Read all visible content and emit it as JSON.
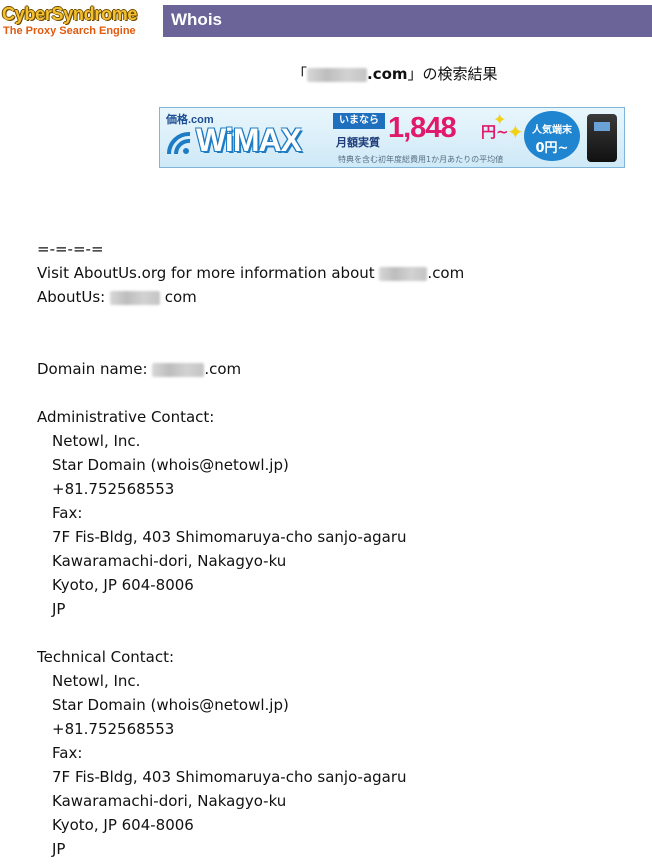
{
  "header": {
    "logo_main": "CyberSyndrome",
    "logo_sub": "The Proxy Search Engine",
    "title": "Whois"
  },
  "result": {
    "open_quote": "「",
    "domain_suffix": ".com",
    "close_text": "」の検索結果"
  },
  "banner": {
    "kakaku": "価格.com",
    "brand": "WiMAX",
    "now_label": "いまなら",
    "monthly_label": "月額実質",
    "price": "1,848",
    "yen": "円~",
    "popular_label": "人気端末",
    "popular_price": "0円~",
    "note": "特典を含む初年度総費用1か月あたりの平均値"
  },
  "whois": {
    "separator": "=-=-=-=",
    "visit_prefix": "Visit AboutUs.org for more information about ",
    "visit_suffix": ".com",
    "aboutus_prefix": "AboutUs: ",
    "aboutus_suffix": "com",
    "domain_prefix": "Domain name: ",
    "domain_suffix": ".com",
    "admin": {
      "heading": "Administrative Contact:",
      "lines": [
        "Netowl, Inc.",
        "Star Domain (whois@netowl.jp)",
        "+81.752568553",
        "Fax:",
        "7F Fis-Bldg, 403 Shimomaruya-cho sanjo-agaru",
        "Kawaramachi-dori, Nakagyo-ku",
        "Kyoto, JP 604-8006",
        "JP"
      ]
    },
    "tech": {
      "heading": "Technical Contact:",
      "lines": [
        "Netowl, Inc.",
        "Star Domain (whois@netowl.jp)",
        "+81.752568553",
        "Fax:",
        "7F Fis-Bldg, 403 Shimomaruya-cho sanjo-agaru",
        "Kawaramachi-dori, Nakagyo-ku",
        "Kyoto, JP 604-8006",
        "JP"
      ]
    }
  },
  "colors": {
    "title_bar": "#6a6499",
    "logo_gold": "#f5c030",
    "logo_orange": "#e05a10",
    "price_pink": "#e0196b",
    "wimax_blue": "#1e7cc4"
  }
}
